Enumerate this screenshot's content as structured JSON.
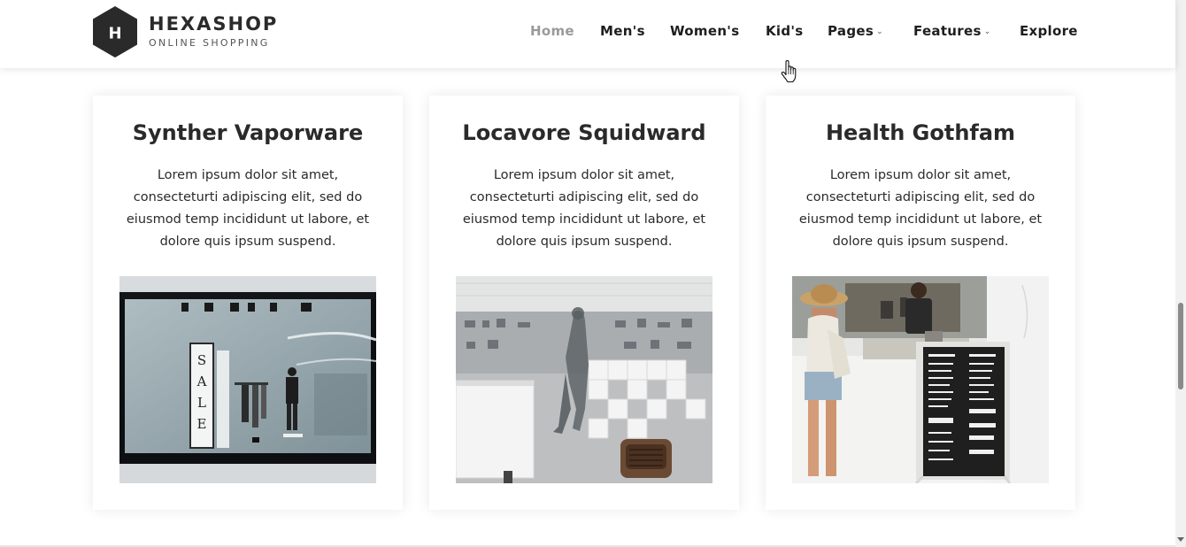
{
  "brand": {
    "letter": "H",
    "title": "HEXASHOP",
    "subtitle": "ONLINE SHOPPING",
    "color": "#2a2a2a"
  },
  "nav": {
    "items": [
      {
        "label": "Home",
        "active": true,
        "dropdown": false
      },
      {
        "label": "Men's",
        "active": false,
        "dropdown": false
      },
      {
        "label": "Women's",
        "active": false,
        "dropdown": false
      },
      {
        "label": "Kid's",
        "active": false,
        "dropdown": false
      },
      {
        "label": "Pages",
        "active": false,
        "dropdown": true
      },
      {
        "label": "Features",
        "active": false,
        "dropdown": true
      },
      {
        "label": "Explore",
        "active": false,
        "dropdown": false
      }
    ],
    "dropdown_icon": "chevron-down-icon"
  },
  "cards": [
    {
      "title": "Synther Vaporware",
      "text": "Lorem ipsum dolor sit amet, consecteturti adipiscing elit, sed do eiusmod temp incididunt ut labore, et dolore quis ipsum suspend.",
      "image": "storefront-sale-photo",
      "sign_text": "SALE"
    },
    {
      "title": "Locavore Squidward",
      "text": "Lorem ipsum dolor sit amet, consecteturti adipiscing elit, sed do eiusmod temp incididunt ut labore, et dolore quis ipsum suspend.",
      "image": "store-interior-photo"
    },
    {
      "title": "Health Gothfam",
      "text": "Lorem ipsum dolor sit amet, consecteturti adipiscing elit, sed do eiusmod temp incididunt ut labore, et dolore quis ipsum suspend.",
      "image": "cafe-counter-photo"
    }
  ],
  "colors": {
    "text": "#2a2a2a",
    "nav_active": "#9a9a9a",
    "card_bg": "#ffffff"
  }
}
